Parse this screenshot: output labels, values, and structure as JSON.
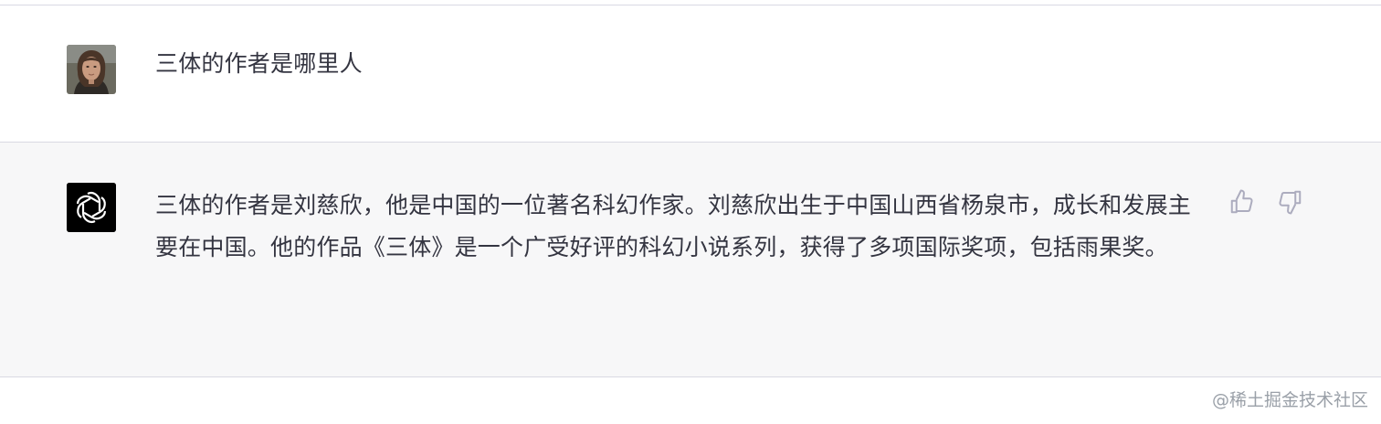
{
  "messages": [
    {
      "role": "user",
      "avatar": "user-photo-avatar",
      "text": "三体的作者是哪里人"
    },
    {
      "role": "assistant",
      "avatar": "openai-logo-icon",
      "text": "三体的作者是刘慈欣，他是中国的一位著名科幻作家。刘慈欣出生于中国山西省杨泉市，成长和发展主要在中国。他的作品《三体》是一个广受好评的科幻小说系列，获得了多项国际奖项，包括雨果奖。",
      "feedback": {
        "thumbs_up_icon": "thumbs-up-icon",
        "thumbs_down_icon": "thumbs-down-icon"
      }
    }
  ],
  "watermark": "@稀土掘金技术社区",
  "colors": {
    "user_bg": "#ffffff",
    "assistant_bg": "#f7f7f8",
    "text": "#343541",
    "icon": "#acacbe",
    "divider": "#d9d9e3"
  }
}
